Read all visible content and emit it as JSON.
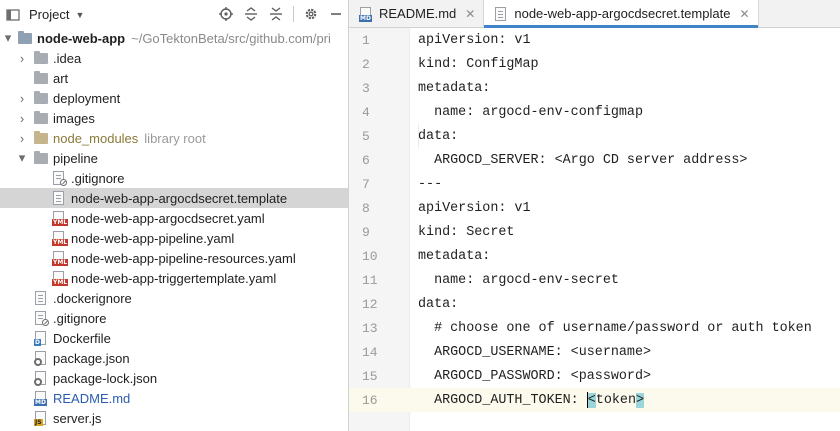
{
  "project_panel": {
    "title": "Project",
    "tools": [
      "locate-icon",
      "expand-all-icon",
      "collapse-all-icon",
      "settings-icon",
      "hide-icon"
    ],
    "root": {
      "name": "node-web-app",
      "path": "~/GoTektonBeta/src/github.com/pri"
    },
    "items": [
      {
        "label": ".idea"
      },
      {
        "label": "art"
      },
      {
        "label": "deployment"
      },
      {
        "label": "images"
      },
      {
        "label": "node_modules",
        "tag": "library root"
      },
      {
        "label": "pipeline"
      },
      {
        "label": ".gitignore"
      },
      {
        "label": "node-web-app-argocdsecret.template"
      },
      {
        "label": "node-web-app-argocdsecret.yaml"
      },
      {
        "label": "node-web-app-pipeline.yaml"
      },
      {
        "label": "node-web-app-pipeline-resources.yaml"
      },
      {
        "label": "node-web-app-triggertemplate.yaml"
      },
      {
        "label": ".dockerignore"
      },
      {
        "label": ".gitignore"
      },
      {
        "label": "Dockerfile"
      },
      {
        "label": "package.json"
      },
      {
        "label": "package-lock.json"
      },
      {
        "label": "README.md"
      },
      {
        "label": "server.js"
      }
    ]
  },
  "editor": {
    "tabs": [
      {
        "label": "README.md",
        "badge": "MD"
      },
      {
        "label": "node-web-app-argocdsecret.template"
      }
    ],
    "badges": {
      "yml": "YML",
      "md": "MD",
      "d": "D",
      "js": "JS"
    },
    "lines": [
      {
        "num": "1",
        "text": "apiVersion: v1"
      },
      {
        "num": "2",
        "text": "kind: ConfigMap"
      },
      {
        "num": "3",
        "text": "metadata:"
      },
      {
        "num": "4",
        "text": "  name: argocd-env-configmap"
      },
      {
        "num": "5",
        "text": "data:"
      },
      {
        "num": "6",
        "text": "  ARGOCD_SERVER: <Argo CD server address>"
      },
      {
        "num": "7",
        "text": "---"
      },
      {
        "num": "8",
        "text": "apiVersion: v1"
      },
      {
        "num": "9",
        "text": "kind: Secret"
      },
      {
        "num": "10",
        "text": "metadata:"
      },
      {
        "num": "11",
        "text": "  name: argocd-env-secret"
      },
      {
        "num": "12",
        "text": "data:"
      },
      {
        "num": "13",
        "text": "  # choose one of username/password or auth token"
      },
      {
        "num": "14",
        "text": "  ARGOCD_USERNAME: <username>"
      },
      {
        "num": "15",
        "text": "  ARGOCD_PASSWORD: <password>"
      },
      {
        "num": "16",
        "text_before": "  ARGOCD_AUTH_TOKEN: ",
        "text_open": "<",
        "text_mid": "token",
        "text_close": ">"
      }
    ]
  },
  "colors": {
    "selection": "#d5d5d5",
    "tab_accent": "#4083c9",
    "brace_highlight": "#99d5d9",
    "current_line": "#fcfaed"
  }
}
